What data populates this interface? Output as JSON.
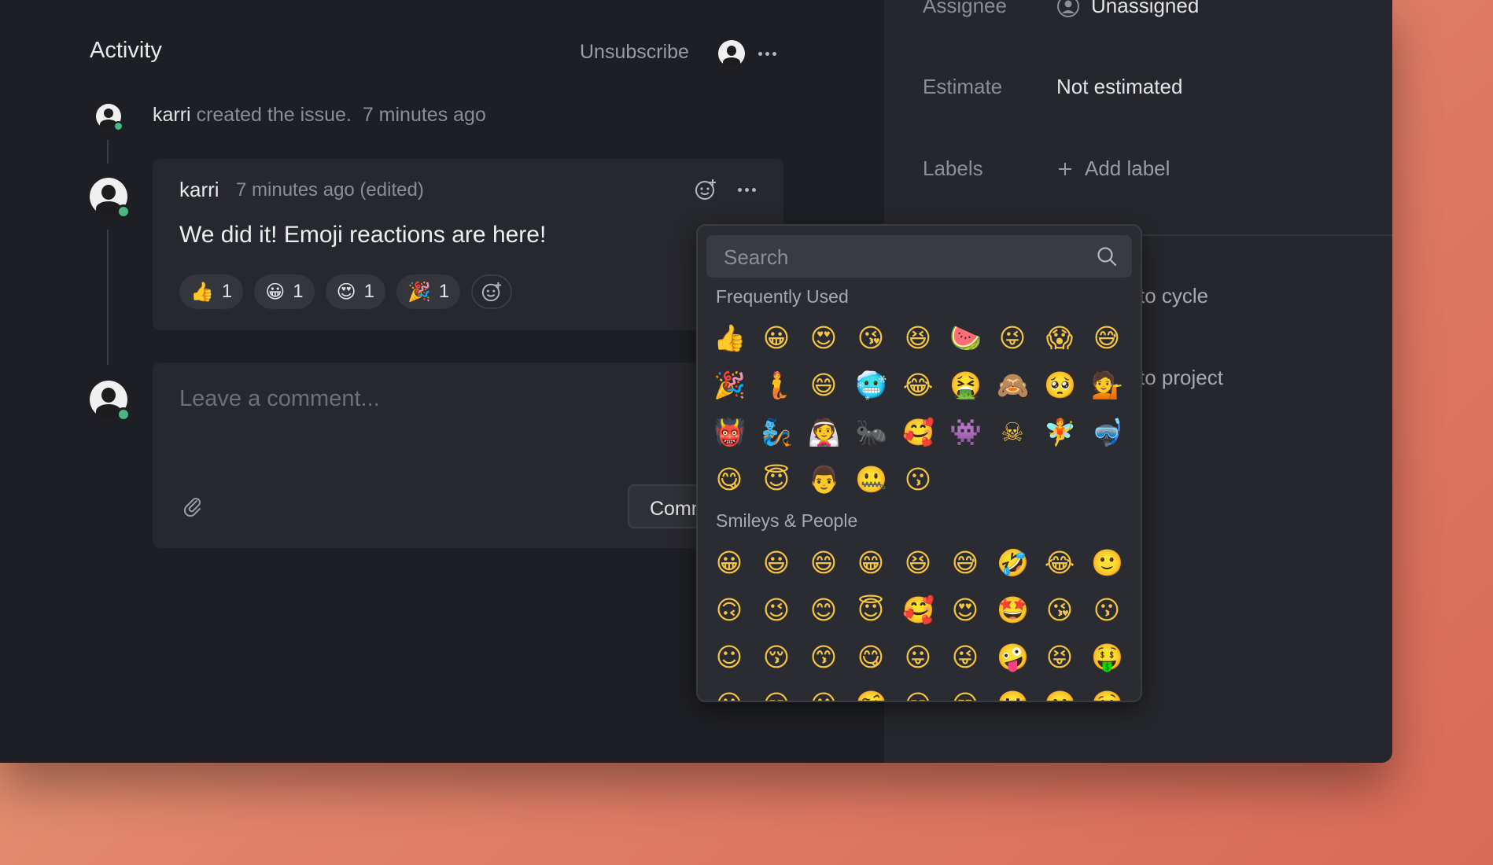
{
  "activity": {
    "title": "Activity",
    "unsubscribe": "Unsubscribe"
  },
  "history": {
    "user": "karri",
    "action": "created the issue.",
    "time": "7 minutes ago"
  },
  "comment": {
    "author": "karri",
    "time": "7 minutes ago (edited)",
    "body": "We did it! Emoji reactions are here!",
    "reactions": [
      {
        "emoji": "👍",
        "count": "1"
      },
      {
        "emoji": "😀",
        "count": "1"
      },
      {
        "emoji": "😍",
        "count": "1"
      },
      {
        "emoji": "🎉",
        "count": "1"
      }
    ]
  },
  "composer": {
    "placeholder": "Leave a comment...",
    "submit_label": "Comm"
  },
  "properties": {
    "assignee_label": "Assignee",
    "assignee_value": "Unassigned",
    "estimate_label": "Estimate",
    "estimate_value": "Not estimated",
    "labels_label": "Labels",
    "add_label": "Add label",
    "cycle_partial": "to cycle",
    "project_partial": "to project"
  },
  "emoji_picker": {
    "search_placeholder": "Search",
    "frequent_title": "Frequently Used",
    "frequent": [
      "👍",
      "😀",
      "😍",
      "😘",
      "😆",
      "🍉",
      "😜",
      "😱",
      "😅",
      "🎉",
      "🧜",
      "😄",
      "🥶",
      "😂",
      "🤮",
      "🙈",
      "🥺",
      "💁",
      "👹",
      "🧞",
      "👰",
      "🐜",
      "🥰",
      "👾",
      "☠",
      "🧚",
      "🤿",
      "😋",
      "😇",
      "👨",
      "🤐",
      "😗"
    ],
    "smileys_title": "Smileys & People",
    "smileys": [
      "😀",
      "😃",
      "😄",
      "😁",
      "😆",
      "😅",
      "🤣",
      "😂",
      "🙂",
      "🙃",
      "😉",
      "😊",
      "😇",
      "🥰",
      "😍",
      "🤩",
      "😘",
      "😗",
      "☺",
      "😚",
      "😙",
      "😋",
      "😛",
      "😜",
      "🤪",
      "😝",
      "🤑",
      "😐",
      "😑",
      "😶",
      "🤨",
      "😏",
      "😒",
      "🙄",
      "😬",
      "🤥"
    ]
  },
  "colors": {
    "background": "#1e1f24",
    "panel": "#26272c",
    "online": "#4cb782"
  }
}
